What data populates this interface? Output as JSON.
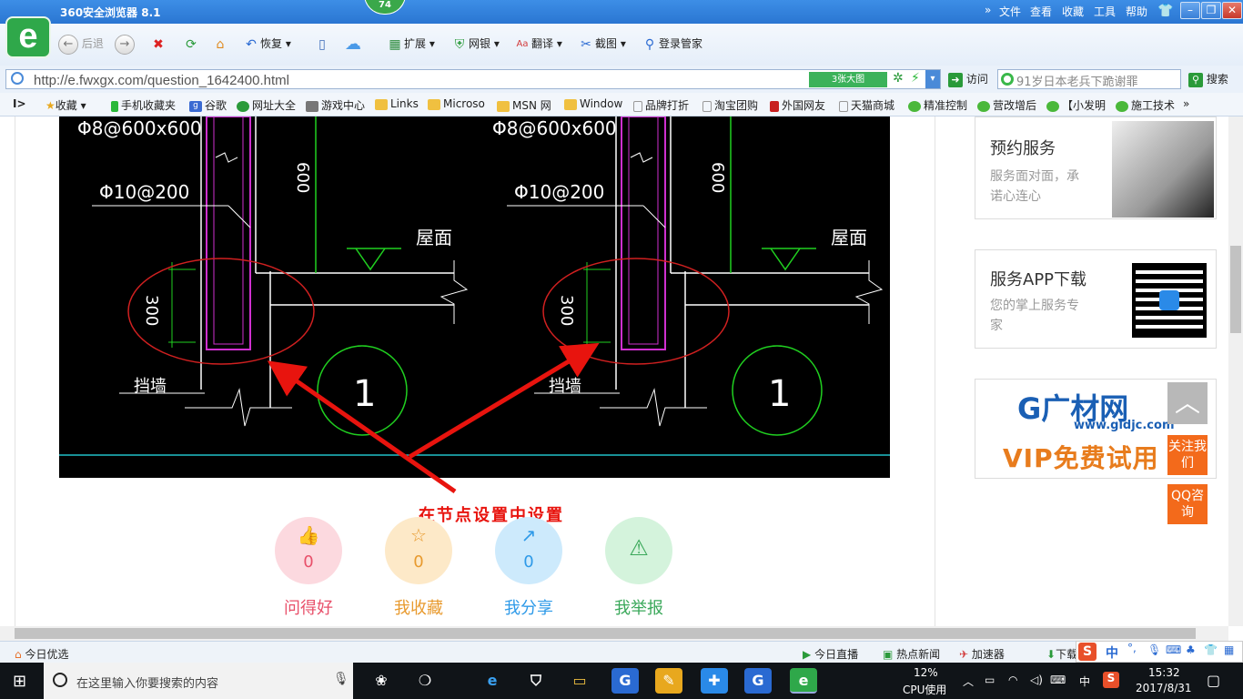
{
  "browser": {
    "title": "360安全浏览器 8.1",
    "badge": "74",
    "menu": [
      "文件",
      "查看",
      "收藏",
      "工具",
      "帮助"
    ],
    "nav": {
      "back": "后退",
      "restore": "恢复"
    },
    "toolbar": [
      "扩展",
      "网银",
      "翻译",
      "截图",
      "登录管家"
    ],
    "url": "http://e.fwxgx.com/question_1642400.html",
    "big_image_button": "3张大图",
    "visit": "访问",
    "search_placeholder": "91岁日本老兵下跪谢罪",
    "search_button": "搜索"
  },
  "favorites": [
    "收藏",
    "手机收藏夹",
    "谷歌",
    "网址大全",
    "游戏中心",
    "Links",
    "Microso",
    "MSN 网",
    "Window",
    "品牌打折",
    "淘宝团购",
    "外国网友",
    "天猫商城",
    "精准控制",
    "营改增后",
    "【小发明",
    "施工技术"
  ],
  "drawing": {
    "rebar_top": "Φ8@600x600",
    "rebar_mid": "Φ10@200",
    "roof": "屋面",
    "dim_600": "600",
    "dim_300": "300",
    "wall": "挡墙",
    "detail_no": "1"
  },
  "caption": "在节点设置中设置",
  "actions": [
    {
      "label": "问得好",
      "count": "0",
      "icon": "thumbs-up",
      "color": "#e8506a",
      "bg": "#fcd9df"
    },
    {
      "label": "我收藏",
      "count": "0",
      "icon": "star",
      "color": "#e89a2e",
      "bg": "#fde9c8"
    },
    {
      "label": "我分享",
      "count": "0",
      "icon": "share",
      "color": "#2e9ae8",
      "bg": "#cdeafc"
    },
    {
      "label": "我举报",
      "count": "",
      "icon": "warning",
      "color": "#3aa85a",
      "bg": "#d4f3dc"
    }
  ],
  "sidebar": {
    "card1": {
      "title": "预约服务",
      "sub1": "服务面对面，承",
      "sub2": "诺心连心"
    },
    "card2": {
      "title": "服务APP下载",
      "sub1": "您的掌上服务专",
      "sub2": "家"
    },
    "card3": {
      "logo": "G广材网",
      "url": "www.gldjc.com",
      "vip": "VIP免费试用"
    },
    "follow": "关注我们",
    "qq": "QQ咨询"
  },
  "statusbar": {
    "left": "今日优选",
    "items": [
      "今日直播",
      "热点新闻",
      "加速器",
      "下载"
    ]
  },
  "taskbar": {
    "search": "在这里输入你要搜索的内容",
    "cpu": "12%",
    "cpu_label": "CPU使用",
    "ime": "中",
    "time": "15:32",
    "date": "2017/8/31"
  }
}
